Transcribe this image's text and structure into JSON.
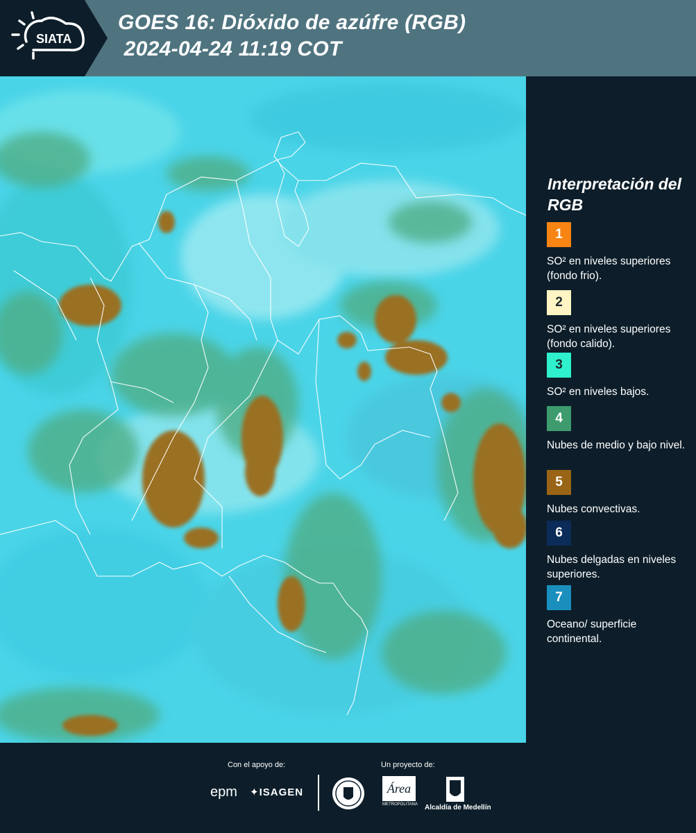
{
  "header": {
    "logo_text": "SIATA",
    "title": "GOES 16: Dióxido de azúfre (RGB)\n 2024-04-24 11:19 COT"
  },
  "legend": {
    "title": "Interpretación del RGB",
    "items": [
      {
        "number": "1",
        "color": "#f78413",
        "label": "SO² en niveles superiores (fondo frio)."
      },
      {
        "number": "2",
        "color": "#fff4c4",
        "label": "SO² en niveles superiores (fondo calido)."
      },
      {
        "number": "3",
        "color": "#2ef0cc",
        "label": "SO² en niveles bajos."
      },
      {
        "number": "4",
        "color": "#3d9b6d",
        "label": "Nubes de medio y bajo nivel."
      },
      {
        "number": "5",
        "color": "#996415",
        "label": "Nubes convectivas."
      },
      {
        "number": "6",
        "color": "#0b2b59",
        "label": "Nubes delgadas en niveles superiores."
      },
      {
        "number": "7",
        "color": "#1a8fbe",
        "label": "Oceano/ superficie continental."
      }
    ]
  },
  "footer": {
    "support_label": "Con el apoyo de:",
    "project_label": "Un proyecto de:",
    "sponsors": [
      "epm",
      "ISAGEN"
    ],
    "partners": [
      "METROPOLITANA",
      "Alcaldía de Medellín"
    ]
  }
}
